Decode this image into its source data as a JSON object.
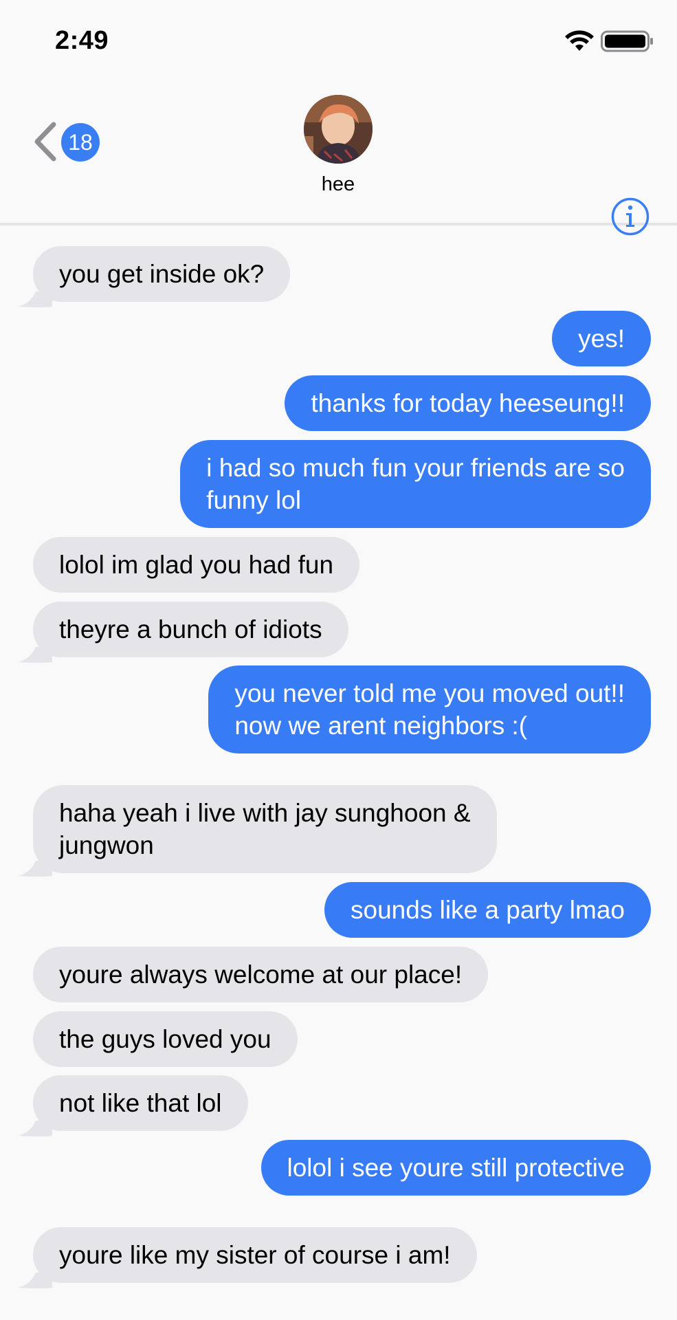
{
  "status_bar": {
    "time": "2:49",
    "icons": [
      "wifi-icon",
      "battery-icon"
    ]
  },
  "header": {
    "back_icon": "chevron-left-icon",
    "unread_count": "18",
    "contact_name": "hee",
    "info_icon": "info-icon"
  },
  "colors": {
    "sent_bubble": "#377cf5",
    "received_bubble": "#e4e4e9",
    "accent": "#3a7ef3",
    "background": "#f9f9f9"
  },
  "messages": [
    {
      "direction": "received",
      "text": "you get inside ok?"
    },
    {
      "direction": "sent",
      "text": "yes!"
    },
    {
      "direction": "sent",
      "text": "thanks for today heeseung!!"
    },
    {
      "direction": "sent",
      "lines": [
        "i had so much fun your friends are so",
        "funny lol"
      ]
    },
    {
      "direction": "received",
      "text": "lolol im glad you had fun"
    },
    {
      "direction": "received",
      "text": "theyre a bunch of idiots"
    },
    {
      "direction": "sent",
      "lines": [
        "you never told me you moved out!!",
        "now we arent neighbors :("
      ]
    },
    {
      "direction": "received",
      "lines": [
        "haha yeah i live with jay sunghoon &",
        "jungwon"
      ]
    },
    {
      "direction": "sent",
      "text": "sounds like a party lmao"
    },
    {
      "direction": "received",
      "text": "youre always welcome at our place!"
    },
    {
      "direction": "received",
      "text": "the guys loved you"
    },
    {
      "direction": "received",
      "text": "not like that lol"
    },
    {
      "direction": "sent",
      "text": "lolol i see youre still protective"
    },
    {
      "direction": "received",
      "text": "youre like my sister of course i am!"
    }
  ]
}
